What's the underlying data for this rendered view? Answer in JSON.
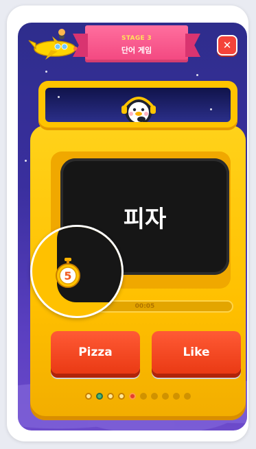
{
  "header": {
    "stage_label": "STAGE 3",
    "stage_title": "단어 게임"
  },
  "quiz": {
    "word": "피자",
    "timer_text": "00:05",
    "countdown": "5",
    "answers": [
      "Pizza",
      "Like"
    ]
  },
  "progress": {
    "total": 10,
    "current_index": 4,
    "states": [
      "done",
      "wrong",
      "done",
      "done",
      "current",
      "todo",
      "todo",
      "todo",
      "todo",
      "todo"
    ]
  },
  "icons": {
    "close": "close-icon",
    "plane": "plane-icon",
    "mascot": "penguin-mascot",
    "timer": "stopwatch-icon"
  },
  "colors": {
    "background": "#3a2f9e",
    "machine": "#ffc400",
    "screen": "#161616",
    "button": "#ea3a14",
    "banner": "#f2467f",
    "accent": "#ffe25a"
  }
}
